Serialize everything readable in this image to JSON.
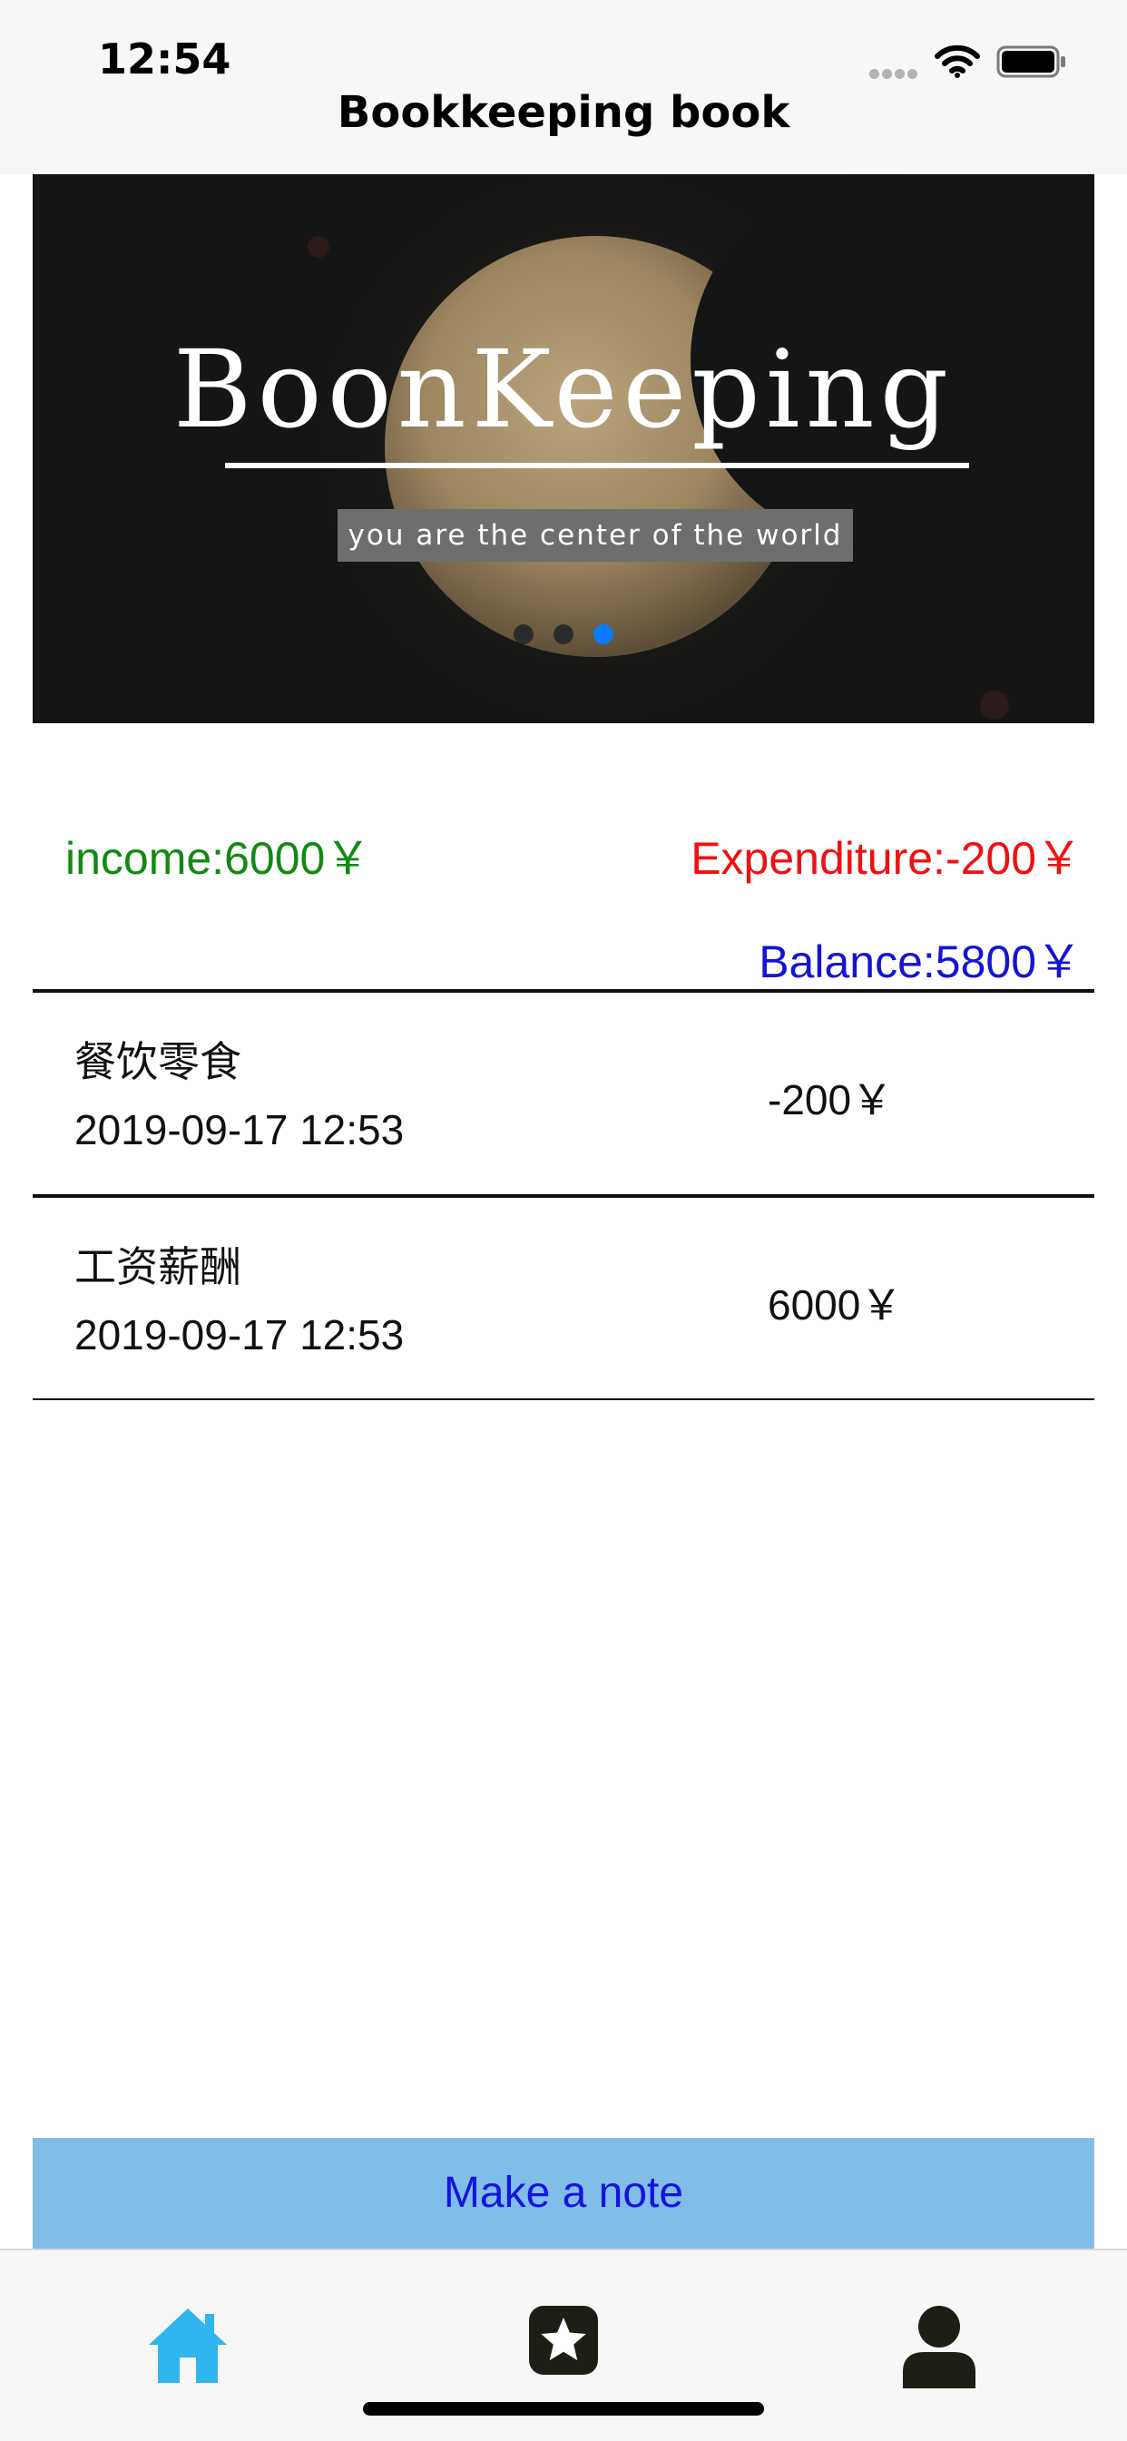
{
  "status_bar": {
    "time": "12:54",
    "icons": [
      "signal-dots-icon",
      "wifi-icon",
      "battery-icon"
    ]
  },
  "nav": {
    "title": "Bookkeeping book"
  },
  "banner": {
    "title": "BoonKeeping",
    "subtitle": "you are the center of the world",
    "page_count": 3,
    "active_page": 3
  },
  "summary": {
    "income": "income:6000￥",
    "expenditure": "Expenditure:-200￥",
    "balance": "Balance:5800￥"
  },
  "records": [
    {
      "category": "餐饮零食",
      "time": "2019-09-17 12:53",
      "amount": "-200￥"
    },
    {
      "category": "工资薪酬",
      "time": "2019-09-17 12:53",
      "amount": "6000￥"
    }
  ],
  "note_button": {
    "label": "Make a note"
  },
  "tab_bar": {
    "tabs": [
      {
        "icon": "home-icon",
        "selected": true
      },
      {
        "icon": "star-icon",
        "selected": false
      },
      {
        "icon": "person-icon",
        "selected": false
      }
    ]
  },
  "colors": {
    "income": "#118a11",
    "expenditure": "#ee1111",
    "balance": "#1414d6",
    "accent": "#0a7bff",
    "tab_selected": "#2fb6ee",
    "note_button_bg": "#80bde9"
  }
}
